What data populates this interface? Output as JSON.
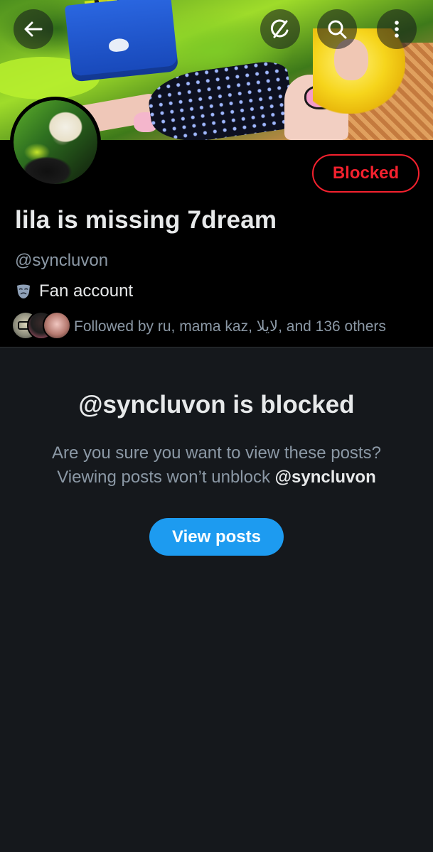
{
  "banner": {
    "back_icon": "arrow-left-icon",
    "grok_icon": "grok-icon",
    "search_icon": "search-icon",
    "more_icon": "more-vertical-icon"
  },
  "profile": {
    "display_name": "lila is missing 7dream",
    "handle": "@syncluvon",
    "bio_icon": "theater-mask-icon",
    "bio_text": "Fan account",
    "followed_by_text": "Followed by ru, mama kaz, لايلا, and 136 others",
    "blocked_button_label": "Blocked"
  },
  "notice": {
    "title": "@syncluvon is blocked",
    "line1": "Are you sure you want to view these posts?",
    "line2_prefix": "Viewing posts won’t unblock ",
    "line2_handle": "@syncluvon",
    "view_button_label": "View posts"
  },
  "colors": {
    "background": "#15181c",
    "profile_bg": "#000000",
    "blocked_red": "#f4212e",
    "accent_blue": "#1d9bf0",
    "secondary_text": "#8b98a5",
    "primary_text": "#e7e9ea"
  }
}
